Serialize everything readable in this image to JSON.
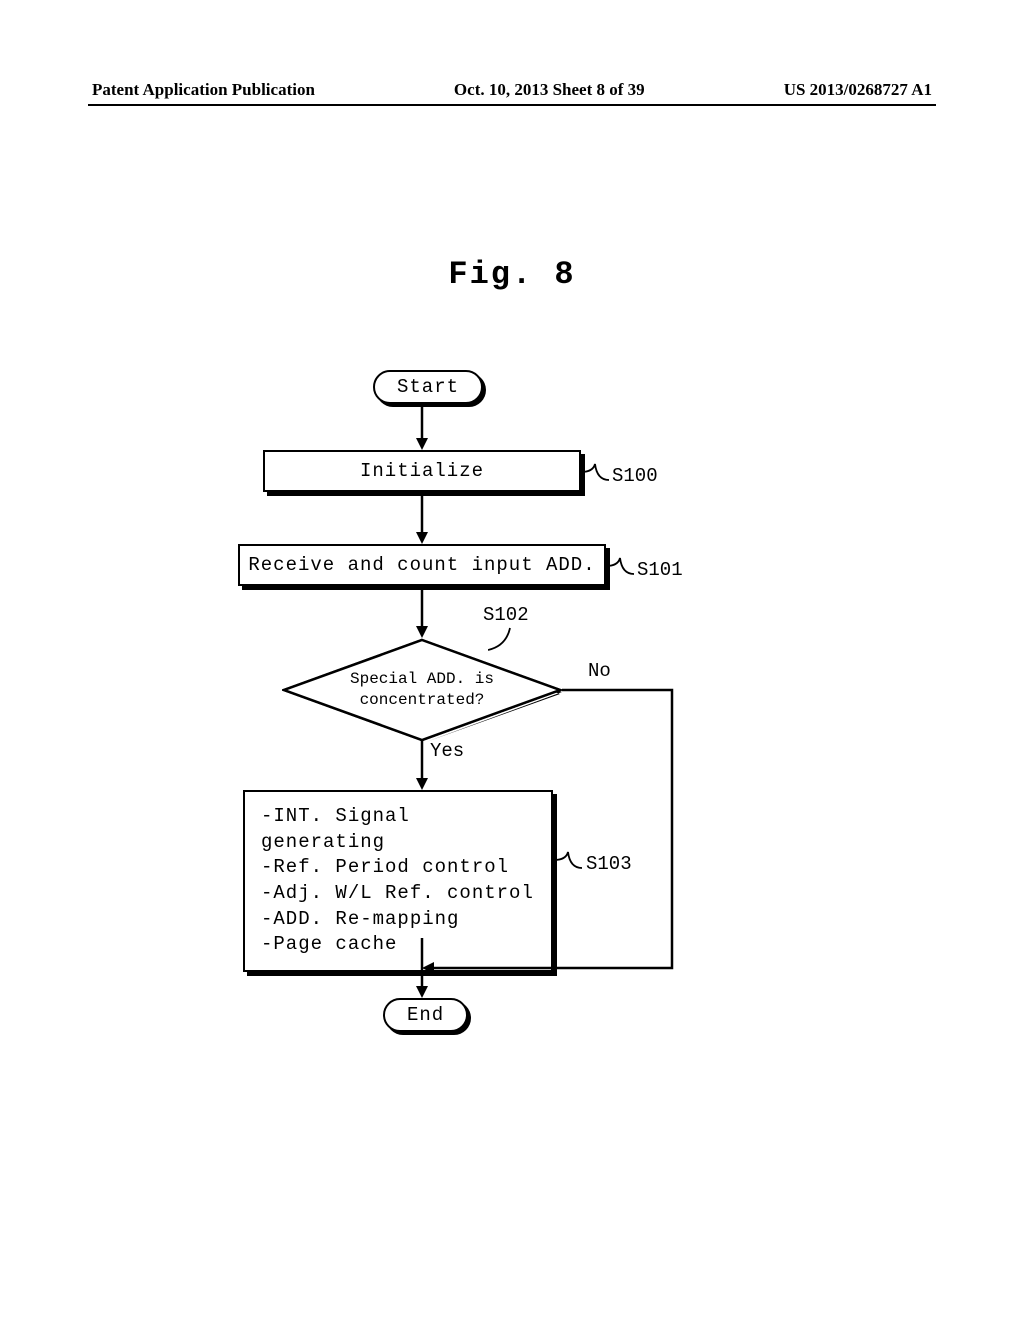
{
  "header": {
    "left": "Patent Application Publication",
    "center": "Oct. 10, 2013  Sheet 8 of 39",
    "right": "US 2013/0268727 A1"
  },
  "figure_title": "Fig. 8",
  "nodes": {
    "start": "Start",
    "s100": "Initialize",
    "s101": "Receive and count input ADD.",
    "s102_line1": "Special ADD. is",
    "s102_line2": "concentrated?",
    "s103_l1": "-INT. Signal generating",
    "s103_l2": "-Ref. Period control",
    "s103_l3": "-Adj. W/L Ref. control",
    "s103_l4": "-ADD. Re-mapping",
    "s103_l5": "-Page cache",
    "end": "End"
  },
  "labels": {
    "s100": "S100",
    "s101": "S101",
    "s102": "S102",
    "s103": "S103",
    "yes": "Yes",
    "no": "No"
  }
}
